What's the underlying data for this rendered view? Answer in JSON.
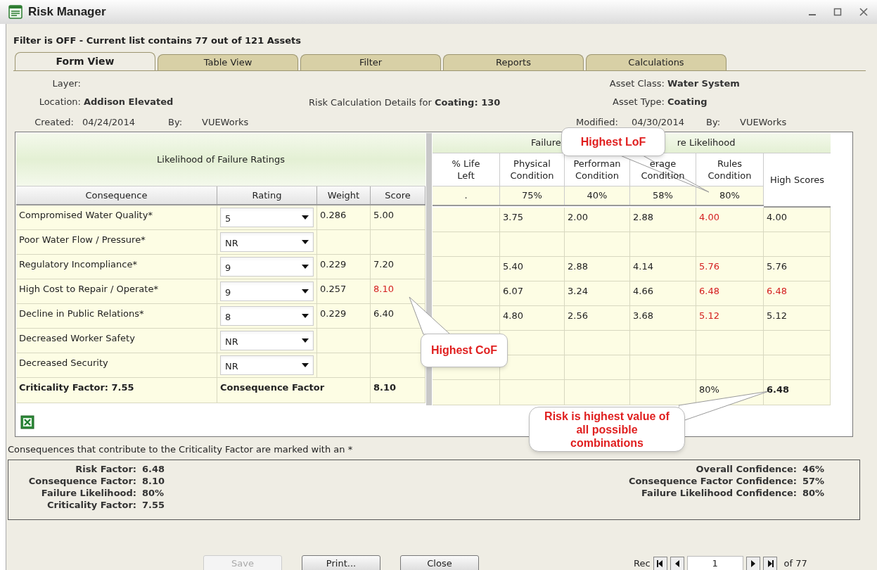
{
  "window": {
    "title": "Risk Manager"
  },
  "filter_status": "Filter is OFF -  Current list contains 77 out of 121 Assets",
  "tabs": [
    {
      "label": "Form View",
      "selected": true
    },
    {
      "label": "Table View",
      "selected": false
    },
    {
      "label": "Filter",
      "selected": false
    },
    {
      "label": "Reports",
      "selected": false
    },
    {
      "label": "Calculations",
      "selected": false
    }
  ],
  "details": {
    "layer_label": "Layer:",
    "location_label": "Location:",
    "location": "Addison Elevated",
    "created_label": "Created:",
    "created": "04/24/2014",
    "created_by_label": "By:",
    "created_by": "VUEWorks",
    "calc_prefix": "Risk Calculation Details for ",
    "calc_subject": "Coating: 130",
    "asset_class_label": "Asset Class:",
    "asset_class": "Water System",
    "asset_type_label": "Asset Type:",
    "asset_type": "Coating",
    "modified_label": "Modified:",
    "modified": "04/30/2014",
    "modified_by_label": "By:",
    "modified_by": "VUEWorks"
  },
  "table": {
    "left_title": "Likelihood of Failure Ratings",
    "right_title_parts": [
      "Failure",
      "re Likelihood"
    ],
    "left_columns": [
      "Consequence",
      "Rating",
      "Weight",
      "Score"
    ],
    "right_columns": [
      {
        "lines": [
          "% Life",
          "Left"
        ],
        "pct": "."
      },
      {
        "lines": [
          "Physical",
          "Condition"
        ],
        "pct": "75%"
      },
      {
        "lines": [
          "Performan",
          "Condition"
        ],
        "pct": "40%"
      },
      {
        "lines": [
          "erage",
          "Condition"
        ],
        "pct": "58%"
      },
      {
        "lines": [
          "Rules",
          "Condition"
        ],
        "pct": "80%"
      }
    ],
    "high_scores_header": "High Scores",
    "rows": [
      {
        "consequence": "Compromised Water Quality*",
        "rating": "5",
        "weight": "0.286",
        "score": {
          "text": "5.00",
          "highlight": false
        },
        "values": [
          {
            "text": "3.75",
            "highlight": false
          },
          {
            "text": "2.00",
            "highlight": false
          },
          {
            "text": "2.88",
            "highlight": false
          },
          {
            "text": "4.00",
            "highlight": true
          },
          {
            "text": "4.00",
            "highlight": false
          }
        ]
      },
      {
        "consequence": "Poor Water Flow / Pressure*",
        "rating": "NR"
      },
      {
        "consequence": "Regulatory Incompliance*",
        "rating": "9",
        "weight": "0.229",
        "score": {
          "text": "7.20",
          "highlight": false
        },
        "values": [
          {
            "text": "5.40",
            "highlight": false
          },
          {
            "text": "2.88",
            "highlight": false
          },
          {
            "text": "4.14",
            "highlight": false
          },
          {
            "text": "5.76",
            "highlight": true
          },
          {
            "text": "5.76",
            "highlight": false
          }
        ]
      },
      {
        "consequence": "High Cost to Repair / Operate*",
        "rating": "9",
        "weight": "0.257",
        "score": {
          "text": "8.10",
          "highlight": true
        },
        "values": [
          {
            "text": "6.07",
            "highlight": false
          },
          {
            "text": "3.24",
            "highlight": false
          },
          {
            "text": "4.66",
            "highlight": false
          },
          {
            "text": "6.48",
            "highlight": true
          },
          {
            "text": "6.48",
            "highlight": true
          }
        ]
      },
      {
        "consequence": "Decline in Public Relations*",
        "rating": "8",
        "weight": "0.229",
        "score": {
          "text": "6.40",
          "highlight": false
        },
        "values": [
          {
            "text": "4.80",
            "highlight": false
          },
          {
            "text": "2.56",
            "highlight": false
          },
          {
            "text": "3.68",
            "highlight": false
          },
          {
            "text": "5.12",
            "highlight": true
          },
          {
            "text": "5.12",
            "highlight": false
          }
        ]
      },
      {
        "consequence": "Decreased Worker Safety",
        "rating": "NR"
      },
      {
        "consequence": "Decreased Security",
        "rating": "NR"
      }
    ],
    "totals": {
      "criticality": "Criticality Factor: 7.55",
      "consequence_label": "Consequence Factor",
      "consequence_value": "8.10",
      "rules": "80%",
      "high": "6.48"
    }
  },
  "note": "Consequences that contribute to the Criticality Factor are marked with an *",
  "summary_left": [
    {
      "label": "Risk Factor:",
      "value": "6.48"
    },
    {
      "label": "Consequence Factor:",
      "value": "8.10"
    },
    {
      "label": "Failure Likelihood:",
      "value": "80%"
    },
    {
      "label": "Criticality Factor:",
      "value": "7.55"
    }
  ],
  "summary_right": [
    {
      "label": "Overall Confidence:",
      "value": "46%"
    },
    {
      "label": "Consequence Factor Confidence:",
      "value": "57%"
    },
    {
      "label": "Failure Likelihood Confidence:",
      "value": "80%"
    }
  ],
  "callouts": [
    {
      "text": "Highest LoF"
    },
    {
      "text": "Highest CoF"
    },
    {
      "text": "Risk is highest value of all possible combinations"
    }
  ],
  "buttons": [
    {
      "label": "Save",
      "disabled": true
    },
    {
      "label": "Print...",
      "disabled": false
    },
    {
      "label": "Close",
      "disabled": false
    }
  ],
  "pager": {
    "label": "Rec",
    "value": "1",
    "total": "of 77"
  }
}
